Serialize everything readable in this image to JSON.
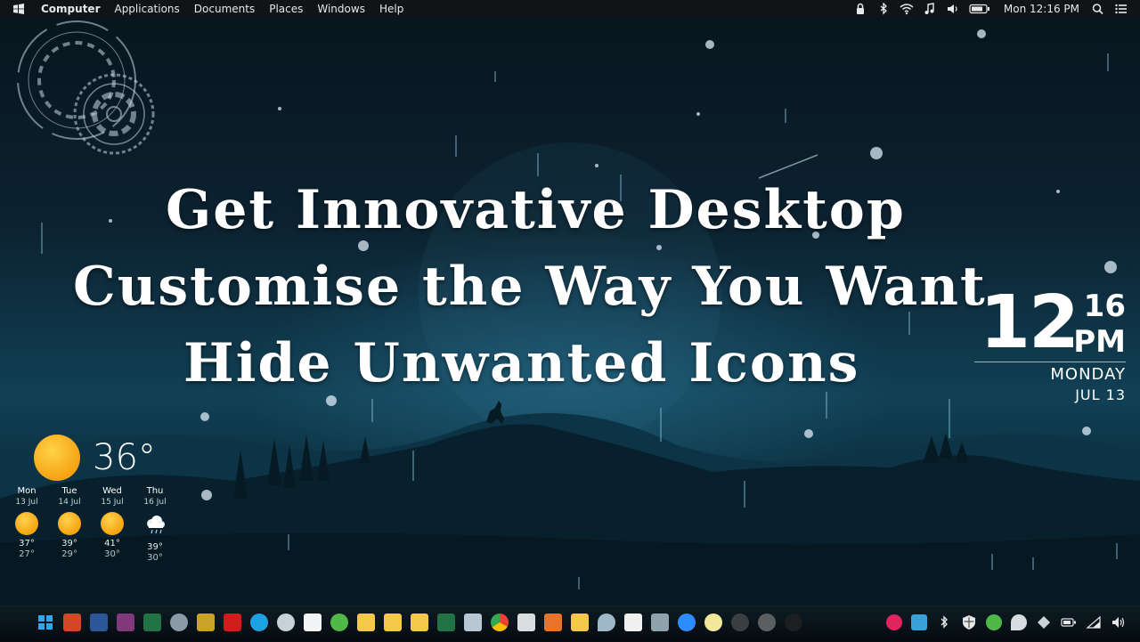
{
  "menubar": {
    "items": [
      "Computer",
      "Applications",
      "Documents",
      "Places",
      "Windows",
      "Help"
    ],
    "clock": "Mon 12:16 PM",
    "tray_icons": [
      "lock-icon",
      "bluetooth-icon",
      "wifi-icon",
      "music-note-icon",
      "volume-icon",
      "battery-icon",
      "search-icon",
      "list-icon"
    ]
  },
  "headline": {
    "line1": "Get Innovative Desktop",
    "line2": "Customise the Way You Want",
    "line3": "Hide Unwanted Icons"
  },
  "clock_widget": {
    "hour": "12",
    "minute": "16",
    "ampm": "PM",
    "day": "MONDAY",
    "date": "JUL 13"
  },
  "weather": {
    "current_temp": "36°",
    "current_icon": "sun-icon",
    "days": [
      {
        "name": "Mon",
        "date": "13 Jul",
        "icon": "sun-icon",
        "high": "37°",
        "low": "27°"
      },
      {
        "name": "Tue",
        "date": "14 Jul",
        "icon": "sun-icon",
        "high": "39°",
        "low": "29°"
      },
      {
        "name": "Wed",
        "date": "15 Jul",
        "icon": "sun-icon",
        "high": "41°",
        "low": "30°"
      },
      {
        "name": "Thu",
        "date": "16 Jul",
        "icon": "rain-cloud-icon",
        "high": "39°",
        "low": "30°"
      }
    ]
  },
  "colors": {
    "menubar_bg": "#111416",
    "sky_top": "#07141c",
    "sky_glow": "#114055",
    "sun": "#f5a312",
    "text": "#ffffff"
  }
}
